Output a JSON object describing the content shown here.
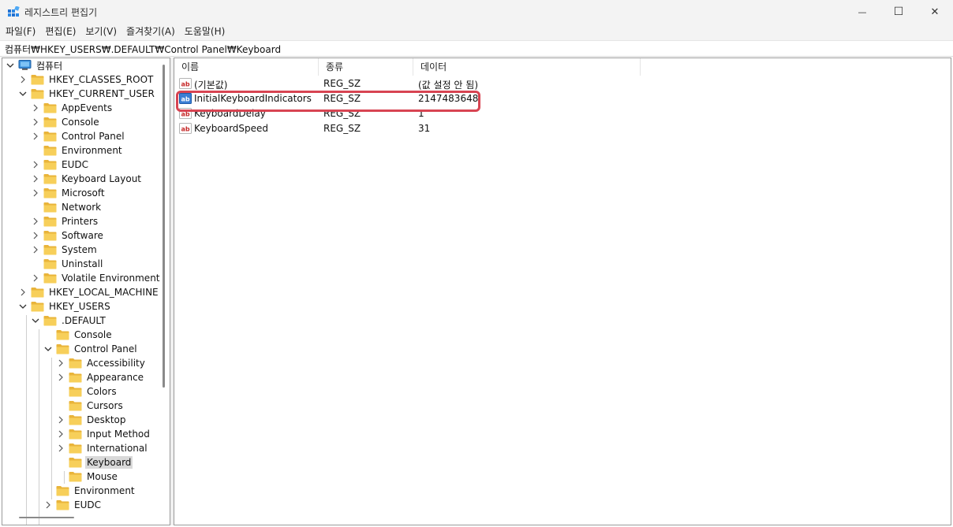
{
  "window": {
    "title": "레지스트리 편집기",
    "minimize_glyph": "—",
    "maximize_glyph": "☐",
    "close_glyph": "✕"
  },
  "menu": [
    "파일(F)",
    "편집(E)",
    "보기(V)",
    "즐겨찾기(A)",
    "도움말(H)"
  ],
  "address": "컴퓨터₩HKEY_USERS₩.DEFAULT₩Control Panel₩Keyboard",
  "tree": {
    "root": "컴퓨터",
    "items": [
      {
        "label": "컴퓨터",
        "level": 0,
        "chevron": "down",
        "icon": "computer-icon"
      },
      {
        "label": "HKEY_CLASSES_ROOT",
        "level": 1,
        "chevron": "right"
      },
      {
        "label": "HKEY_CURRENT_USER",
        "level": 1,
        "chevron": "down"
      },
      {
        "label": "AppEvents",
        "level": 2,
        "chevron": "right"
      },
      {
        "label": "Console",
        "level": 2,
        "chevron": "right"
      },
      {
        "label": "Control Panel",
        "level": 2,
        "chevron": "right"
      },
      {
        "label": "Environment",
        "level": 2,
        "chevron": "none"
      },
      {
        "label": "EUDC",
        "level": 2,
        "chevron": "right"
      },
      {
        "label": "Keyboard Layout",
        "level": 2,
        "chevron": "right"
      },
      {
        "label": "Microsoft",
        "level": 2,
        "chevron": "right"
      },
      {
        "label": "Network",
        "level": 2,
        "chevron": "none"
      },
      {
        "label": "Printers",
        "level": 2,
        "chevron": "right"
      },
      {
        "label": "Software",
        "level": 2,
        "chevron": "right"
      },
      {
        "label": "System",
        "level": 2,
        "chevron": "right"
      },
      {
        "label": "Uninstall",
        "level": 2,
        "chevron": "none"
      },
      {
        "label": "Volatile Environment",
        "level": 2,
        "chevron": "right"
      },
      {
        "label": "HKEY_LOCAL_MACHINE",
        "level": 1,
        "chevron": "right"
      },
      {
        "label": "HKEY_USERS",
        "level": 1,
        "chevron": "down"
      },
      {
        "label": ".DEFAULT",
        "level": 2,
        "chevron": "down"
      },
      {
        "label": "Console",
        "level": 3,
        "chevron": "none"
      },
      {
        "label": "Control Panel",
        "level": 3,
        "chevron": "down"
      },
      {
        "label": "Accessibility",
        "level": 4,
        "chevron": "right"
      },
      {
        "label": "Appearance",
        "level": 4,
        "chevron": "right"
      },
      {
        "label": "Colors",
        "level": 4,
        "chevron": "none"
      },
      {
        "label": "Cursors",
        "level": 4,
        "chevron": "none"
      },
      {
        "label": "Desktop",
        "level": 4,
        "chevron": "right"
      },
      {
        "label": "Input Method",
        "level": 4,
        "chevron": "right"
      },
      {
        "label": "International",
        "level": 4,
        "chevron": "right"
      },
      {
        "label": "Keyboard",
        "level": 4,
        "chevron": "none",
        "selected": true
      },
      {
        "label": "Mouse",
        "level": 4,
        "chevron": "none"
      },
      {
        "label": "Environment",
        "level": 3,
        "chevron": "none"
      },
      {
        "label": "EUDC",
        "level": 3,
        "chevron": "right"
      }
    ]
  },
  "values": {
    "columns": [
      "이름",
      "종류",
      "데이터"
    ],
    "rows": [
      {
        "name": "(기본값)",
        "type": "REG_SZ",
        "data": "(값 설정 안 됨)"
      },
      {
        "name": "InitialKeyboardIndicators",
        "type": "REG_SZ",
        "data": "2147483648",
        "highlighted": true
      },
      {
        "name": "KeyboardDelay",
        "type": "REG_SZ",
        "data": "1"
      },
      {
        "name": "KeyboardSpeed",
        "type": "REG_SZ",
        "data": "31"
      }
    ]
  },
  "colors": {
    "highlight_border": "#d84452",
    "folder": "#f7c948",
    "selected_bg": "#d9d9d9"
  }
}
